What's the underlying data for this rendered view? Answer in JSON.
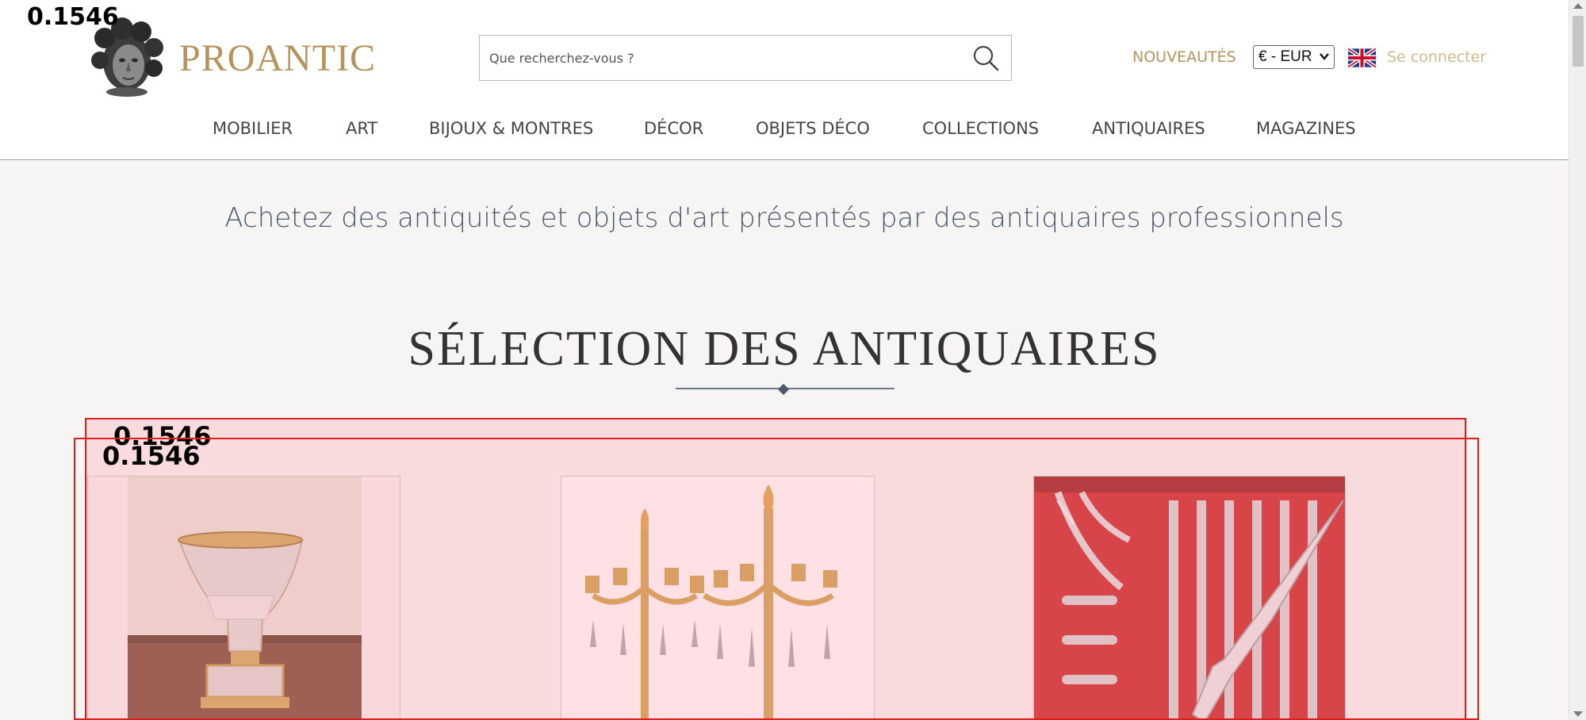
{
  "overlay_labels": {
    "corner": "0.1546",
    "box1": "0.1546",
    "box2": "0.1546"
  },
  "header": {
    "brand": "PROANTIC",
    "search_placeholder": "Que recherchez-vous ?",
    "search_icon": "search-icon",
    "nouveautes": "NOUVEAUTÉS",
    "currency": "€ - EUR",
    "flag_icon": "uk-flag-icon",
    "login": "Se connecter"
  },
  "nav": {
    "items": [
      "MOBILIER",
      "ART",
      "BIJOUX & MONTRES",
      "DÉCOR",
      "OBJETS DÉCO",
      "COLLECTIONS",
      "ANTIQUAIRES",
      "MAGAZINES"
    ]
  },
  "main": {
    "tagline": "Achetez des antiquités et objets d'art présentés par des antiquaires professionnels",
    "section_title": "SÉLECTION DES ANTIQUAIRES"
  },
  "colors": {
    "brand_gold": "#b5935a",
    "tagline_blue": "#4a5b70",
    "overlay_red": "#e01d1d"
  }
}
